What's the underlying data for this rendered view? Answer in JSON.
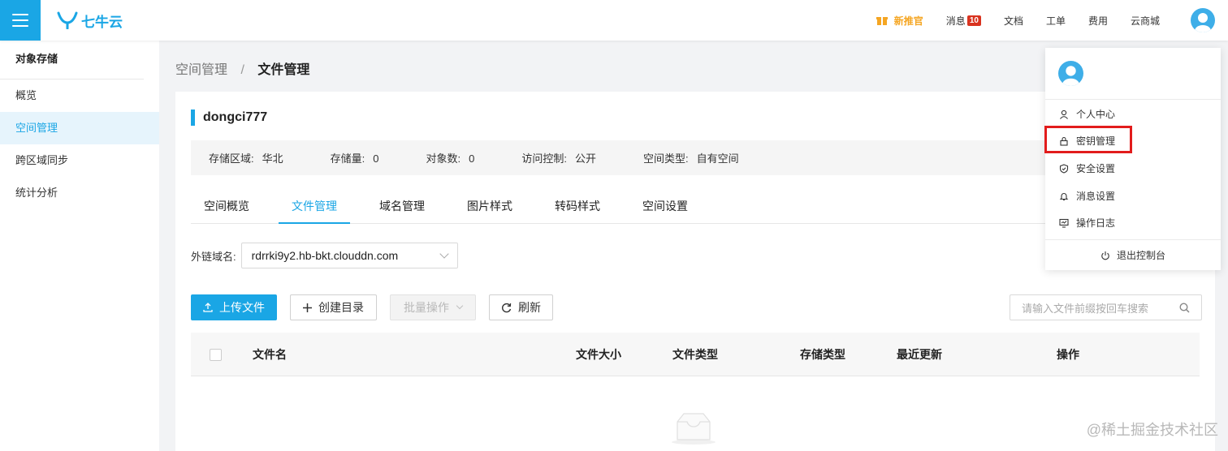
{
  "header": {
    "logo_text": "七牛云",
    "nav": {
      "promo": "新推官",
      "messages": "消息",
      "messages_count": "10",
      "docs": "文档",
      "tickets": "工单",
      "billing": "费用",
      "market": "云商城"
    }
  },
  "sidebar": {
    "title": "对象存储",
    "items": [
      {
        "label": "概览"
      },
      {
        "label": "空间管理"
      },
      {
        "label": "跨区域同步"
      },
      {
        "label": "统计分析"
      }
    ]
  },
  "breadcrumb": {
    "parent": "空间管理",
    "separator": "/",
    "current": "文件管理"
  },
  "bucket": {
    "name": "dongci777",
    "info": [
      {
        "key": "存储区域:",
        "value": "华北"
      },
      {
        "key": "存储量:",
        "value": "0"
      },
      {
        "key": "对象数:",
        "value": "0"
      },
      {
        "key": "访问控制:",
        "value": "公开"
      },
      {
        "key": "空间类型:",
        "value": "自有空间"
      }
    ]
  },
  "tabs": [
    {
      "label": "空间概览"
    },
    {
      "label": "文件管理"
    },
    {
      "label": "域名管理"
    },
    {
      "label": "图片样式"
    },
    {
      "label": "转码样式"
    },
    {
      "label": "空间设置"
    }
  ],
  "domain": {
    "label": "外链域名:",
    "value": "rdrrki9y2.hb-bkt.clouddn.com"
  },
  "toolbar": {
    "upload": "上传文件",
    "create_dir": "创建目录",
    "batch": "批量操作",
    "refresh": "刷新",
    "search_placeholder": "请输入文件前缀按回车搜索"
  },
  "table": {
    "columns": [
      "文件名",
      "文件大小",
      "文件类型",
      "存储类型",
      "最近更新",
      "操作"
    ]
  },
  "user_menu": {
    "items": [
      {
        "label": "个人中心"
      },
      {
        "label": "密钥管理"
      },
      {
        "label": "安全设置"
      },
      {
        "label": "消息设置"
      },
      {
        "label": "操作日志"
      }
    ],
    "logout": "退出控制台"
  },
  "colors": {
    "accent": "#1aa6e5",
    "highlight": "#e21c1c",
    "promo": "#f5a623",
    "badge": "#d9331f"
  },
  "watermark": "@稀土掘金技术社区"
}
